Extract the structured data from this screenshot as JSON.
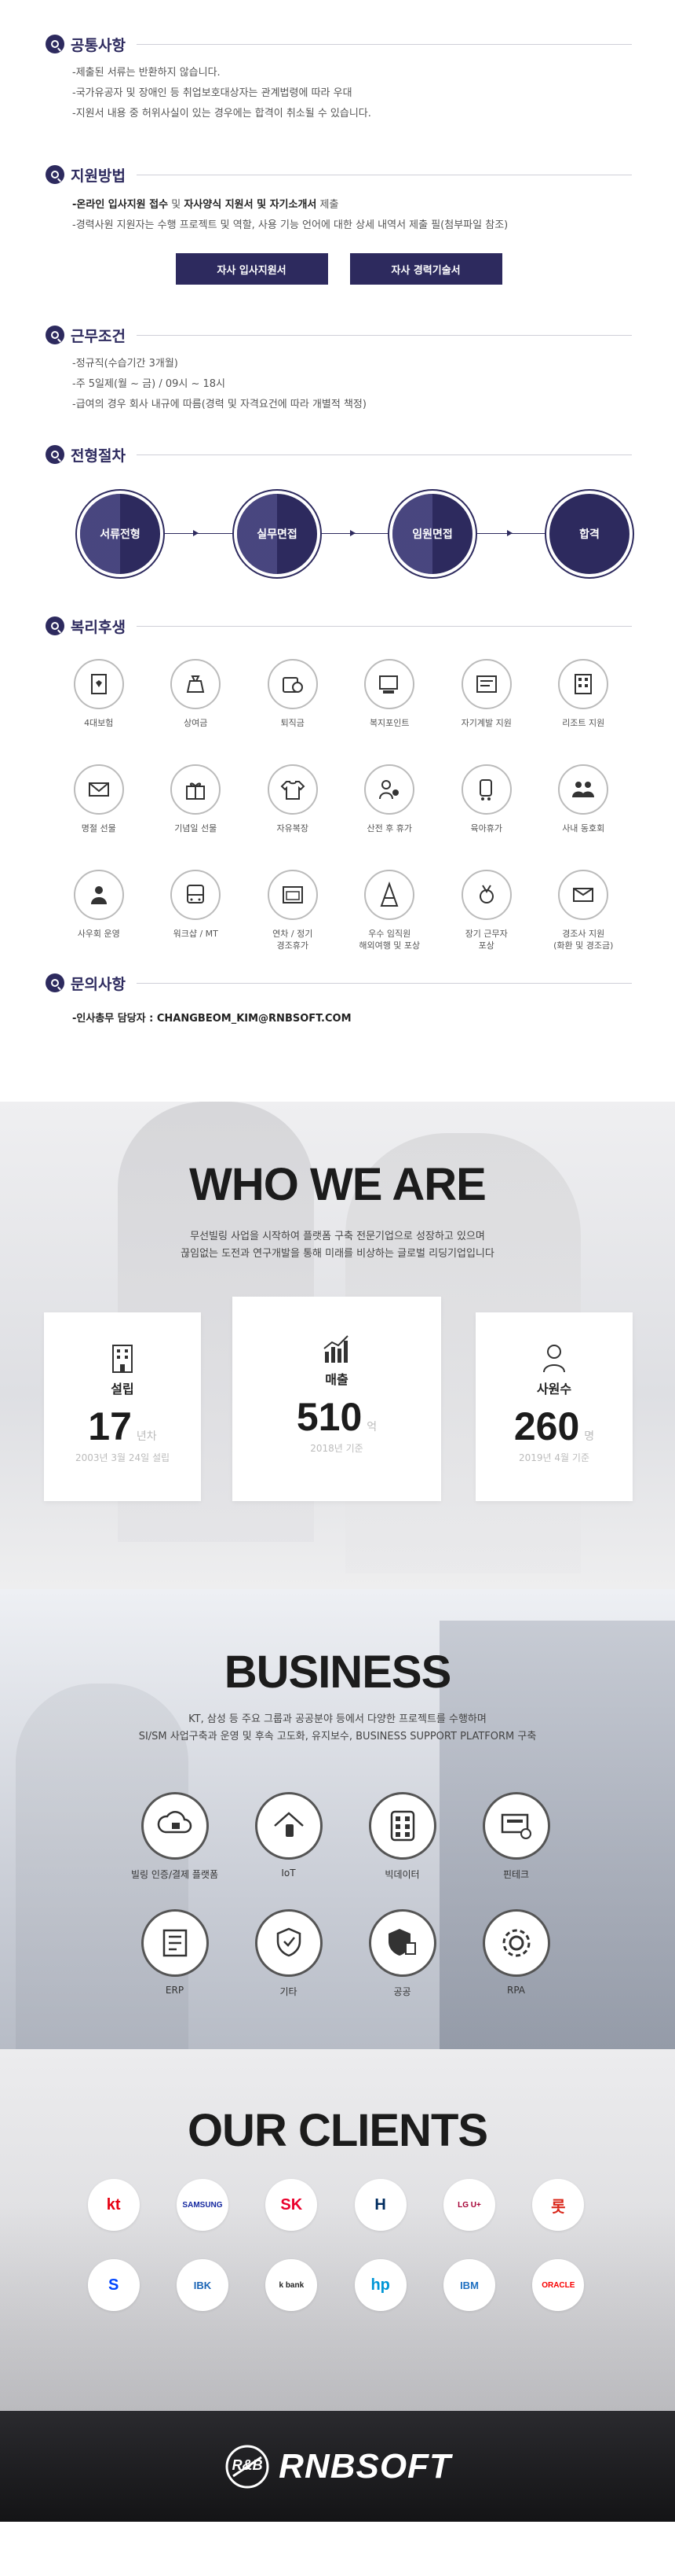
{
  "sections": {
    "notice": {
      "title": "공통사항",
      "items": [
        "-제출된 서류는 반환하지 않습니다.",
        "-국가유공자 및 장애인 등 취업보호대상자는 관계법령에 따라 우대",
        "-지원서 내용 중 허위사실이 있는 경우에는 합격이 취소될 수 있습니다."
      ]
    },
    "apply": {
      "title": "지원방법",
      "line1_a": "-온라인 입사지원 접수",
      "line1_b": " 및 ",
      "line1_c": "자사양식 지원서 및 자기소개서",
      "line1_d": " 제출",
      "line2": "-경력사원 지원자는 수행 프로젝트 및 역할, 사용 기능 언어에 대한 상세 내역서 제출 필(첨부파일 참조)",
      "btn1": "자사 입사지원서",
      "btn2": "자사 경력기술서"
    },
    "terms": {
      "title": "근무조건",
      "items": [
        "-정규직(수습기간 3개월)",
        "-주 5일제(월 ~ 금) / 09시 ~ 18시",
        "-급여의 경우 회사 내규에 따름(경력 및 자격요건에 따라 개별적 책정)"
      ]
    },
    "process": {
      "title": "전형절차",
      "steps": [
        "서류전형",
        "실무면접",
        "임원면접",
        "합격"
      ]
    },
    "benefits": {
      "title": "복리후생",
      "items": [
        {
          "label": "4대보험",
          "icon": "insurance-icon"
        },
        {
          "label": "상여금",
          "icon": "money-bag-icon"
        },
        {
          "label": "퇴직금",
          "icon": "coins-icon"
        },
        {
          "label": "복지포인트",
          "icon": "points-icon"
        },
        {
          "label": "자기계발 지원",
          "icon": "book-icon"
        },
        {
          "label": "리조트 지원",
          "icon": "building-icon"
        },
        {
          "label": "명절 선물",
          "icon": "envelope-icon"
        },
        {
          "label": "기념일 선물",
          "icon": "gift-icon"
        },
        {
          "label": "자유복장",
          "icon": "shirt-icon"
        },
        {
          "label": "산전 후 휴가",
          "icon": "baby-icon"
        },
        {
          "label": "육아휴가",
          "icon": "stroller-icon"
        },
        {
          "label": "사내 동호회",
          "icon": "people-icon"
        },
        {
          "label": "사우회 운영",
          "icon": "group-icon"
        },
        {
          "label": "워크샵 / MT",
          "icon": "bus-icon"
        },
        {
          "label": "연차 / 정기\n경조휴가",
          "icon": "calendar-icon"
        },
        {
          "label": "우수 임직원\n해외여행 및 포상",
          "icon": "eiffel-icon"
        },
        {
          "label": "장기 근무자\n포상",
          "icon": "medal-icon"
        },
        {
          "label": "경조사 지원\n(화환 및 경조금)",
          "icon": "card-envelope-icon"
        }
      ]
    },
    "contact": {
      "title": "문의사항",
      "text": "-인사총무 담당자 : CHANGBEOM_KIM@RNBSOFT.COM"
    }
  },
  "who": {
    "title": "WHO WE ARE",
    "desc1": "무선빌링 사업을 시작하여 플랫폼 구축 전문기업으로 성장하고 있으며",
    "desc2": "끊임없는 도전과 연구개발을 통해 미래를 비상하는 글로벌 리딩기업입니다",
    "cards": [
      {
        "title": "설립",
        "value": "17",
        "unit": "년차",
        "sub": "2003년 3월 24일 설립",
        "icon": "building-icon"
      },
      {
        "title": "매출",
        "value": "510",
        "unit": "억",
        "sub": "2018년 기준",
        "icon": "bar-chart-icon"
      },
      {
        "title": "사원수",
        "value": "260",
        "unit": "명",
        "sub": "2019년 4월 기준",
        "icon": "person-icon"
      }
    ]
  },
  "business": {
    "title": "BUSINESS",
    "desc1": "KT, 삼성 등 주요 그룹과 공공분야 등에서 다양한 프로젝트를 수행하며",
    "desc2": "SI/SM 사업구축과 운영 및 후속 고도화, 유지보수, BUSINESS SUPPORT PLATFORM 구축",
    "items": [
      {
        "label": "빌링 인증/결제 플랫폼",
        "icon": "cloud-lock-icon"
      },
      {
        "label": "IoT",
        "icon": "smart-home-icon"
      },
      {
        "label": "빅데이터",
        "icon": "database-icon"
      },
      {
        "label": "핀테크",
        "icon": "payment-icon"
      },
      {
        "label": "ERP",
        "icon": "erp-icon"
      },
      {
        "label": "기타",
        "icon": "shield-devices-icon"
      },
      {
        "label": "공공",
        "icon": "public-shield-icon"
      },
      {
        "label": "RPA",
        "icon": "gear-icon"
      }
    ]
  },
  "clients": {
    "title": "OUR CLIENTS",
    "logos": [
      {
        "name": "kt",
        "text": "kt",
        "color": "#e60012"
      },
      {
        "name": "samsung",
        "text": "SAMSUNG",
        "color": "#1428a0"
      },
      {
        "name": "sk",
        "text": "SK",
        "color": "#ea002c"
      },
      {
        "name": "hyundai",
        "text": "H",
        "color": "#002c5f"
      },
      {
        "name": "lgu",
        "text": "LG U+",
        "color": "#a50034"
      },
      {
        "name": "lotte",
        "text": "롯",
        "color": "#da291c"
      },
      {
        "name": "shinhan",
        "text": "S",
        "color": "#0046ff"
      },
      {
        "name": "ibk",
        "text": "IBK",
        "color": "#1a64b5"
      },
      {
        "name": "kbank",
        "text": "k bank",
        "color": "#222222"
      },
      {
        "name": "hp",
        "text": "hp",
        "color": "#0096d6"
      },
      {
        "name": "ibm",
        "text": "IBM",
        "color": "#1f70c1"
      },
      {
        "name": "oracle",
        "text": "ORACLE",
        "color": "#f80000"
      }
    ]
  },
  "footer": {
    "mark": "R&B",
    "brand": "RNBSOFT"
  }
}
